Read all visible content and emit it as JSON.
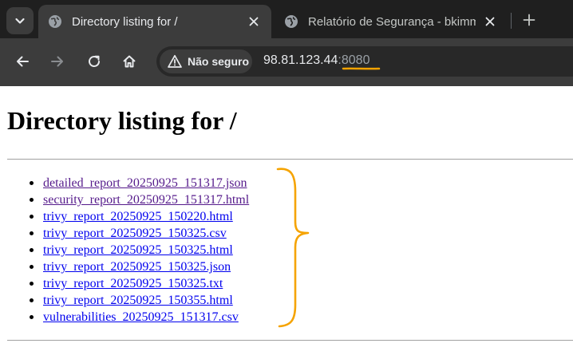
{
  "browser": {
    "tabs": [
      {
        "title": "Directory listing for /",
        "active": true,
        "icon": "globe-icon"
      },
      {
        "title": "Relatório de Segurança - bkimm",
        "active": false,
        "icon": "globe-icon"
      }
    ],
    "address_bar": {
      "security_label": "Não seguro",
      "url_host": "98.81.123.44",
      "url_port": ":8080"
    }
  },
  "page": {
    "title": "Directory listing for /",
    "files": [
      {
        "name": "detailed_report_20250925_151317.json",
        "visited": true
      },
      {
        "name": "security_report_20250925_151317.html",
        "visited": true
      },
      {
        "name": "trivy_report_20250925_150220.html",
        "visited": false
      },
      {
        "name": "trivy_report_20250925_150325.csv",
        "visited": false
      },
      {
        "name": "trivy_report_20250925_150325.html",
        "visited": false
      },
      {
        "name": "trivy_report_20250925_150325.json",
        "visited": false
      },
      {
        "name": "trivy_report_20250925_150325.txt",
        "visited": false
      },
      {
        "name": "trivy_report_20250925_150355.html",
        "visited": false
      },
      {
        "name": "vulnerabilities_20250925_151317.csv",
        "visited": false
      }
    ]
  },
  "annotation": {
    "color": "#f5a300",
    "shape": "curly-brace"
  },
  "colors": {
    "link_visited": "#551a8b",
    "link_unvisited": "#0000ee",
    "chrome_dark": "#1f1f1f",
    "chrome_tab": "#3c3c3c"
  }
}
